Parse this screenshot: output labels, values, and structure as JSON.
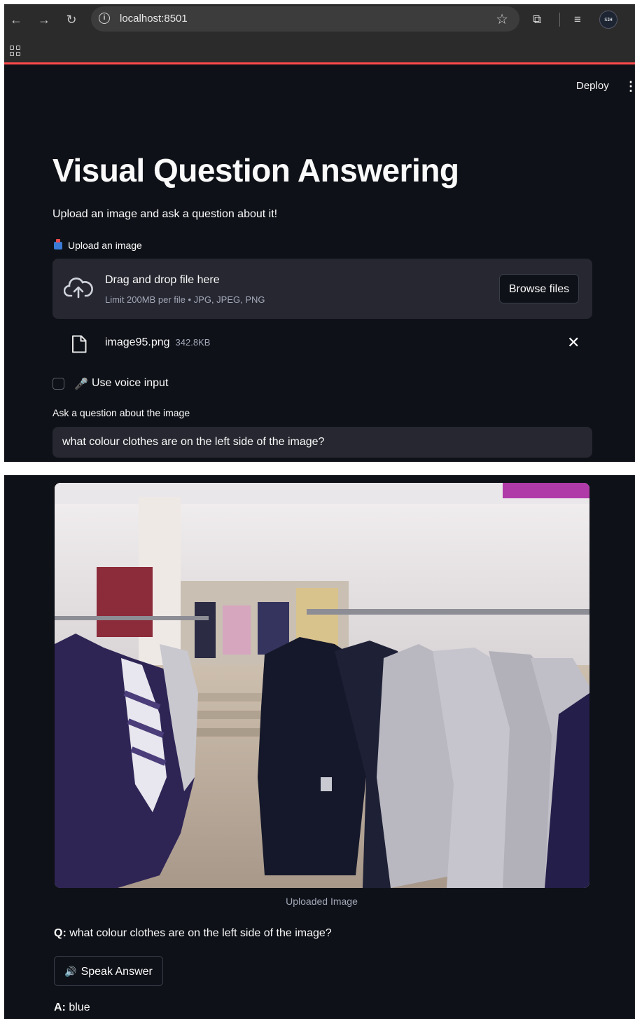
{
  "browser": {
    "url": "localhost:8501",
    "back_icon": "←",
    "forward_icon": "→",
    "reload_icon": "↻",
    "star_icon": "☆",
    "extensions_icon": "⧉",
    "queue_icon": "≡",
    "avatar_text": "ꜱɪʜ"
  },
  "app": {
    "deploy_label": "Deploy",
    "menu_icon": "⋮",
    "title": "Visual Question Answering",
    "subtitle": "Upload an image and ask a question about it!",
    "uploader": {
      "label": "Upload an image",
      "drop_text": "Drag and drop file here",
      "limit_text": "Limit 200MB per file • JPG, JPEG, PNG",
      "browse_label": "Browse files",
      "file_name": "image95.png",
      "file_size": "342.8KB",
      "remove_icon": "✕"
    },
    "voice": {
      "checked": false,
      "mic_icon": "🎤",
      "label": "Use voice input"
    },
    "question": {
      "label": "Ask a question about the image",
      "value": "what colour clothes are on the left side of the image?"
    }
  },
  "result": {
    "image_caption": "Uploaded Image",
    "q_prefix": "Q:",
    "q_text": " what colour clothes are on the left side of the image?",
    "speak_icon": "🔊",
    "speak_label": "Speak Answer",
    "a_prefix": "A:",
    "a_text": " blue"
  },
  "colors": {
    "app_bg": "#0e1117",
    "widget_bg": "#262730",
    "accent": "#ff4b4b",
    "muted_text": "#a3a8b8"
  }
}
